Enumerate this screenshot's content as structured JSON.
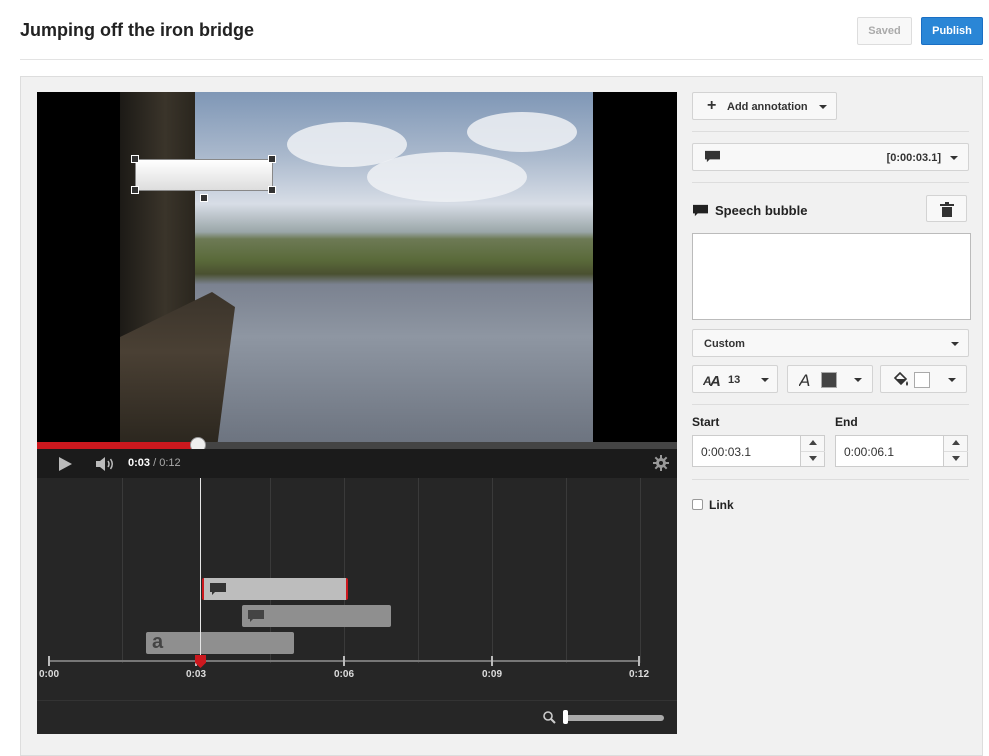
{
  "header": {
    "title": "Jumping off the iron bridge",
    "saved_label": "Saved",
    "publish_label": "Publish"
  },
  "player": {
    "current_time": "0:03",
    "separator": "/",
    "duration": "0:12",
    "progress_fraction": 0.25
  },
  "timeline": {
    "tick_labels": [
      "0:00",
      "0:03",
      "0:06",
      "0:09",
      "0:12"
    ],
    "annotation_tracks": [
      {
        "type": "speech-bubble",
        "selected": true
      },
      {
        "type": "speech-bubble",
        "selected": false
      },
      {
        "type": "title",
        "glyph": "a",
        "selected": false
      }
    ]
  },
  "sidebar": {
    "add_annotation_label": "Add annotation",
    "annotation_selector_time": "[0:00:03.1]",
    "annotation_type_title": "Speech bubble",
    "text_value": "",
    "style_value": "Custom",
    "font_size_value": "13",
    "font_color": "#444444",
    "background_color": "#ffffff",
    "start_label": "Start",
    "end_label": "End",
    "start_value": "0:00:03.1",
    "end_value": "0:00:06.1",
    "link_label": "Link",
    "link_checked": false
  },
  "colors": {
    "accent_red": "#cc181e",
    "publish_blue": "#2a86d6"
  }
}
